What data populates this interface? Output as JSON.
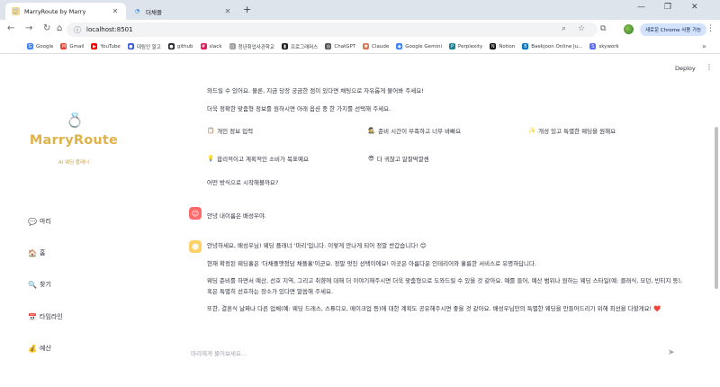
{
  "browser": {
    "tabs": [
      {
        "title": "MarryRoute by Marry",
        "active": true
      },
      {
        "title": "더채플",
        "active": false
      }
    ],
    "url": "localhost:8501",
    "update_button": "새로운 Chrome 사용 가능",
    "bookmarks": [
      {
        "label": "Google",
        "color": "#4285f4",
        "glyph": "G"
      },
      {
        "label": "Gmail",
        "color": "#ea4335",
        "glyph": "M"
      },
      {
        "label": "YouTube",
        "color": "#ff0000",
        "glyph": "▶"
      },
      {
        "label": "대림인 알고",
        "color": "#3b5bdb",
        "glyph": "●"
      },
      {
        "label": "github",
        "color": "#24292e",
        "glyph": "●"
      },
      {
        "label": "slack",
        "color": "#e01e5a",
        "glyph": "#"
      },
      {
        "label": "청년취업사관학교",
        "color": "#9e9e9e",
        "glyph": "○"
      },
      {
        "label": "프로그래머스",
        "color": "#222",
        "glyph": "▮"
      },
      {
        "label": "ChatGPT",
        "color": "#555",
        "glyph": "◎"
      },
      {
        "label": "Claude",
        "color": "#d97757",
        "glyph": "✱"
      },
      {
        "label": "Google Gemini",
        "color": "#4285f4",
        "glyph": "◆"
      },
      {
        "label": "Perplexity",
        "color": "#20808d",
        "glyph": "P"
      },
      {
        "label": "Notion",
        "color": "#111",
        "glyph": "N"
      },
      {
        "label": "Baekjoon Online Ju...",
        "color": "#0076c0",
        "glyph": "B"
      },
      {
        "label": "skywork",
        "color": "#5b6cff",
        "glyph": "S"
      }
    ]
  },
  "app": {
    "deploy_label": "Deploy",
    "logo_icon": "ring-icon",
    "title": "MarryRoute",
    "subtitle": "AI 웨딩 플래너",
    "sidebar": [
      {
        "icon": "💬",
        "label": "마리"
      },
      {
        "icon": "🏠",
        "label": "홈"
      },
      {
        "icon": "🔍",
        "label": "찾기"
      },
      {
        "icon": "📅",
        "label": "타임라인"
      },
      {
        "icon": "💰",
        "label": "예산"
      }
    ]
  },
  "chat": {
    "intro_line1": "와드릴 수 있어요. 물론, 지금 당장 궁금한 점이 있다면 채팅으로 자유롭게 물어봐 주세요!",
    "intro_line2": "더욱 정확한 맞춤형 정보를 원하시면 아래 옵션 중 한 가지를 선택해 주세요.",
    "options": [
      {
        "icon": "📋",
        "label": "개인 정보 입력"
      },
      {
        "icon": "🕵",
        "label": "준비 시간이 부족하고 너무 바빠요"
      },
      {
        "icon": "✨",
        "label": "개성 있고 특별한 웨딩을 원해요"
      },
      {
        "icon": "💡",
        "label": "합리적이고 계획적인 소비가 목표예요"
      },
      {
        "icon": "😎",
        "label": "다 귀찮고 알잘딱깔센"
      }
    ],
    "question": "어떤 방식으로 시작해볼까요?",
    "user_message": "안녕 내이름은 배성우야.",
    "bot_p1": "안녕하세요, 배성우님! 웨딩 플래너 '마리'입니다. 이렇게 만나게 되어 정말 반갑습니다! 😊",
    "bot_p2": "현재 확정된 웨딩홀은 '더채플앳청담 채플홀'이군요. 정말 멋진 선택이에요! 이곳은 아름다운 인테리어와 훌륭한 서비스로 유명하답니다.",
    "bot_p3": "웨딩 준비를 하면서 예산, 선호 지역, 그리고 취향에 대해 더 이야기해주시면 더욱 맞춤형으로 도와드릴 수 있을 것 같아요. 예를 들어, 예산 범위나 원하는 웨딩 스타일(예: 클래식, 모던, 빈티지 등), 혹은 특별히 선호하는 장소가 있다면 말씀해 주세요.",
    "bot_p4": "또한, 결혼식 날짜나 다른 업체(예: 웨딩 드레스, 스튜디오, 메이크업 등)에 대한 계획도 공유해주시면 좋을 것 같아요. 배성우님만의 특별한 웨딩을 만들어드리기 위해 최선을 다할게요! ❤️",
    "input_placeholder": "마리에게 물어보세요..."
  }
}
